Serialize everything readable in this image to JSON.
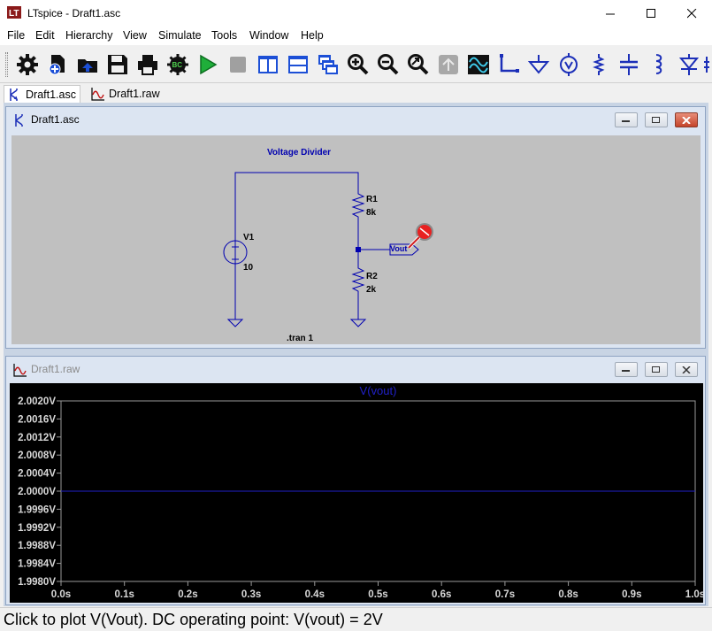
{
  "window": {
    "title": "LTspice - Draft1.asc"
  },
  "menu": [
    "File",
    "Edit",
    "Hierarchy",
    "View",
    "Simulate",
    "Tools",
    "Window",
    "Help"
  ],
  "toolbar_icons": [
    "settings-gear-icon",
    "new-schematic-icon",
    "open-folder-icon",
    "save-icon",
    "print-icon",
    "ac-analysis-icon",
    "run-icon",
    "halt-icon",
    "tile-vertical-icon",
    "tile-horizontal-icon",
    "cascade-icon",
    "zoom-in-icon",
    "zoom-out-icon",
    "zoom-fit-icon",
    "autorange-icon",
    "waveform-icon",
    "wire-icon",
    "ground-icon",
    "voltage-source-icon",
    "resistor-icon",
    "capacitor-icon",
    "inductor-icon",
    "diode-icon"
  ],
  "tabs": [
    {
      "label": "Draft1.asc",
      "active": true
    },
    {
      "label": "Draft1.raw",
      "active": false
    }
  ],
  "schematic": {
    "window_title": "Draft1.asc",
    "comment": "Voltage Divider",
    "components": {
      "v1_name": "V1",
      "v1_value": "10",
      "r1_name": "R1",
      "r1_value": "8k",
      "r2_name": "R2",
      "r2_value": "2k",
      "label": "Vout"
    },
    "directive": ".tran 1"
  },
  "waveform": {
    "window_title": "Draft1.raw",
    "trace_label": "V(vout)",
    "trace_color": "#2020c8"
  },
  "chart_data": {
    "type": "line",
    "title": "V(vout)",
    "x": [
      0.0,
      1.0
    ],
    "series": [
      {
        "name": "V(vout)",
        "values": [
          2.0,
          2.0
        ]
      }
    ],
    "xlim": [
      0.0,
      1.0
    ],
    "ylim": [
      1.998,
      2.002
    ],
    "xticks": [
      "0.0s",
      "0.1s",
      "0.2s",
      "0.3s",
      "0.4s",
      "0.5s",
      "0.6s",
      "0.7s",
      "0.8s",
      "0.9s",
      "1.0s"
    ],
    "yticks": [
      "2.0020V",
      "2.0016V",
      "2.0012V",
      "2.0008V",
      "2.0004V",
      "2.0000V",
      "1.9996V",
      "1.9992V",
      "1.9988V",
      "1.9984V",
      "1.9980V"
    ],
    "grid": false,
    "background": "#000000"
  },
  "status": {
    "text": "Click to plot V(Vout).  DC operating point: V(vout) = 2V"
  }
}
